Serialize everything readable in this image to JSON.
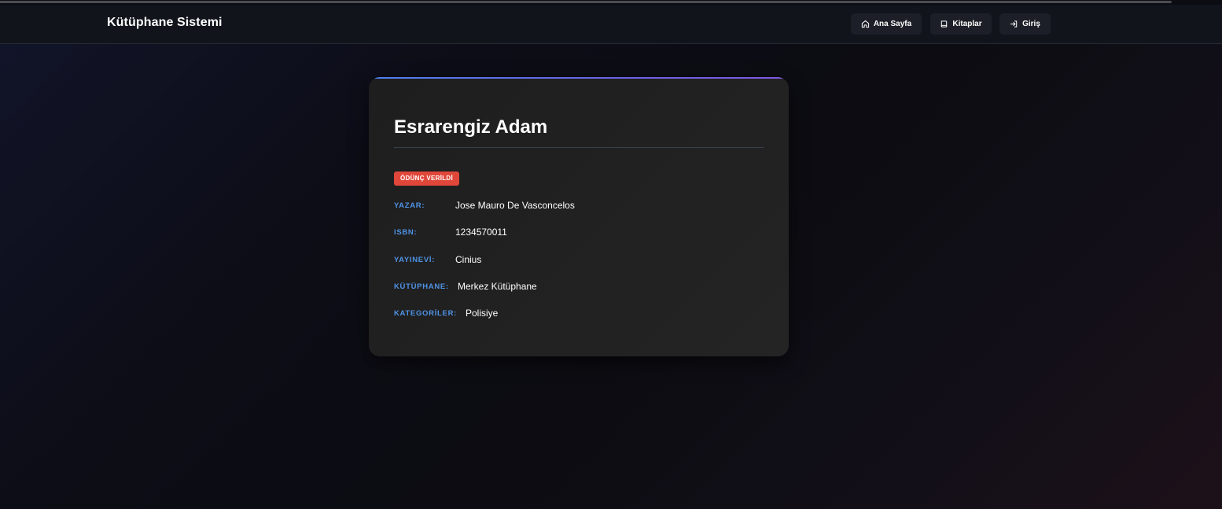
{
  "navbar": {
    "brand": "Kütüphane Sistemi",
    "links": [
      {
        "label": "Ana Sayfa",
        "icon": "home-icon"
      },
      {
        "label": "Kitaplar",
        "icon": "book-icon"
      },
      {
        "label": "Giriş",
        "icon": "login-icon"
      }
    ]
  },
  "book": {
    "title": "Esrarengiz Adam",
    "status": "ÖDÜNÇ VERİLDİ",
    "fields": [
      {
        "label": "YAZAR:",
        "value": "Jose Mauro De Vasconcelos"
      },
      {
        "label": "ISBN:",
        "value": "1234570011"
      },
      {
        "label": "YAYINEVİ:",
        "value": "Cinius"
      },
      {
        "label": "KÜTÜPHANE:",
        "value": "Merkez Kütüphane"
      },
      {
        "label": "KATEGORİLER:",
        "value": "Polisiye"
      }
    ]
  },
  "colors": {
    "accent_blue": "#4f93e6",
    "status_red": "#e0473a",
    "card_top_gradient": "#4f7ff0"
  }
}
